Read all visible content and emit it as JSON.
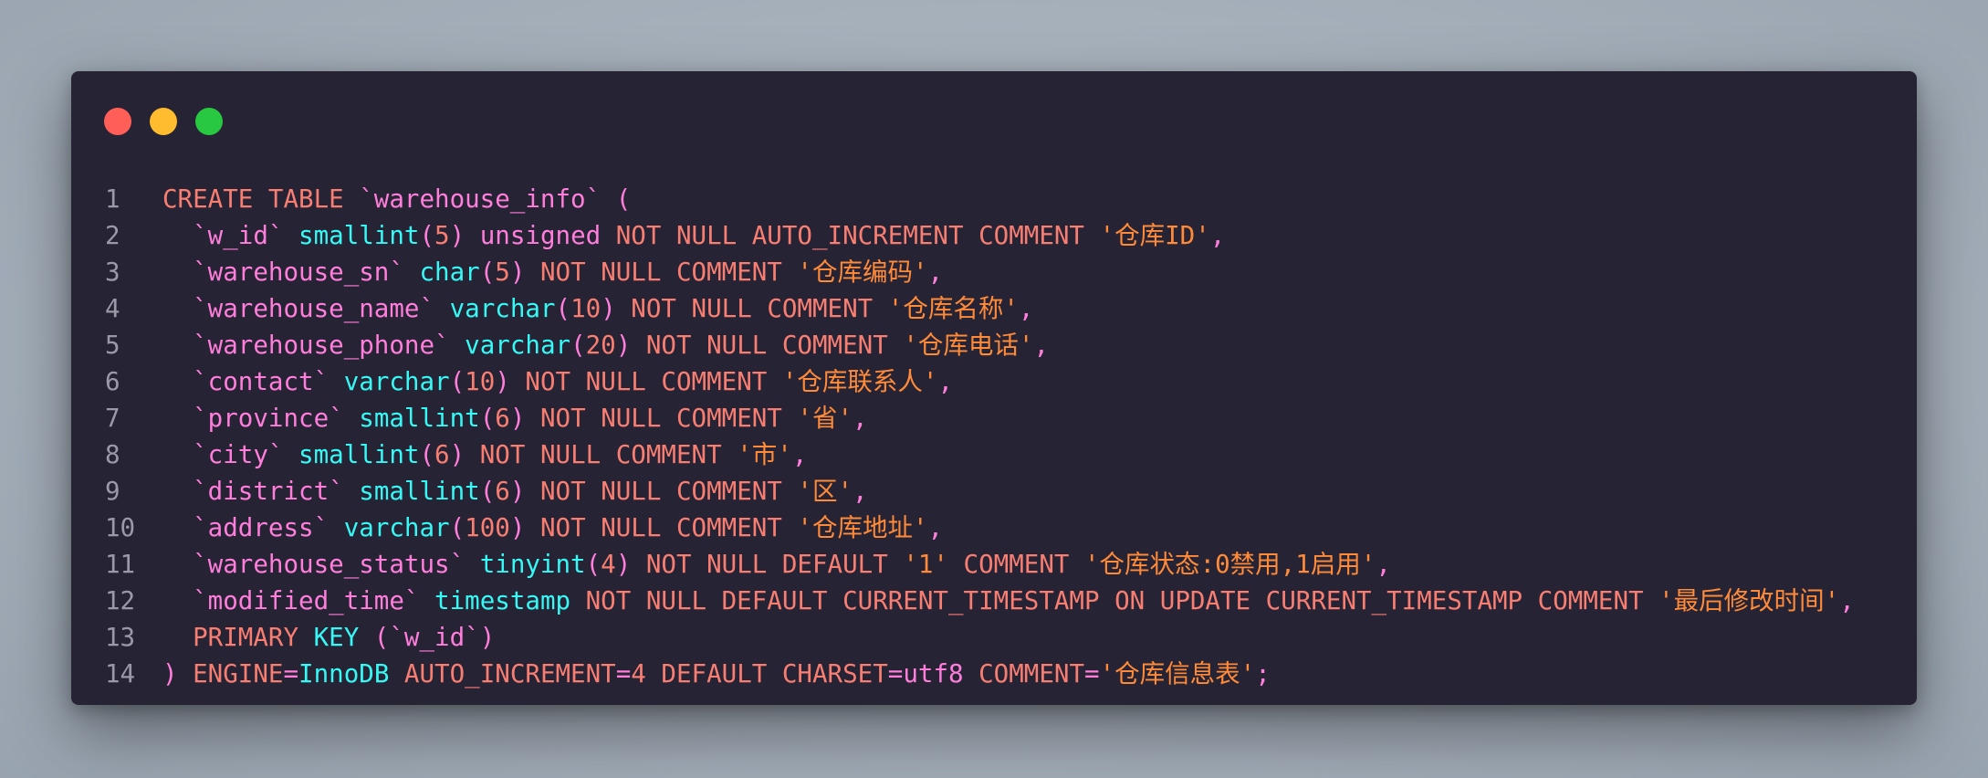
{
  "window": {
    "controls": [
      "close",
      "minimize",
      "maximize"
    ],
    "colors": {
      "background": "#262335",
      "close": "#ff5f57",
      "minimize": "#febc2e",
      "maximize": "#28c840",
      "keyword": "#f97e72",
      "type": "#36f9f6",
      "identifier": "#ff7edb",
      "string": "#ff8b39",
      "line_number": "#9b98a7"
    }
  },
  "code": {
    "language": "SQL",
    "lines": [
      {
        "n": "1",
        "tokens": [
          {
            "t": "CREATE TABLE ",
            "c": "kw2"
          },
          {
            "t": "`warehouse_info`",
            "c": "id"
          },
          {
            "t": " (",
            "c": "pun"
          }
        ]
      },
      {
        "n": "2",
        "tokens": [
          {
            "t": "  ",
            "c": "plain"
          },
          {
            "t": "`w_id`",
            "c": "id"
          },
          {
            "t": " ",
            "c": "plain"
          },
          {
            "t": "smallint",
            "c": "fn"
          },
          {
            "t": "(",
            "c": "pun"
          },
          {
            "t": "5",
            "c": "num"
          },
          {
            "t": ") ",
            "c": "pun"
          },
          {
            "t": "unsigned",
            "c": "id"
          },
          {
            "t": " NOT NULL AUTO_INCREMENT COMMENT ",
            "c": "kw2"
          },
          {
            "t": "'仓库ID'",
            "c": "str"
          },
          {
            "t": ",",
            "c": "pun"
          }
        ]
      },
      {
        "n": "3",
        "tokens": [
          {
            "t": "  ",
            "c": "plain"
          },
          {
            "t": "`warehouse_sn`",
            "c": "id"
          },
          {
            "t": " ",
            "c": "plain"
          },
          {
            "t": "char",
            "c": "fn"
          },
          {
            "t": "(",
            "c": "pun"
          },
          {
            "t": "5",
            "c": "num"
          },
          {
            "t": ")",
            "c": "pun"
          },
          {
            "t": " NOT NULL COMMENT ",
            "c": "kw2"
          },
          {
            "t": "'仓库编码'",
            "c": "str"
          },
          {
            "t": ",",
            "c": "pun"
          }
        ]
      },
      {
        "n": "4",
        "tokens": [
          {
            "t": "  ",
            "c": "plain"
          },
          {
            "t": "`warehouse_name`",
            "c": "id"
          },
          {
            "t": " ",
            "c": "plain"
          },
          {
            "t": "varchar",
            "c": "fn"
          },
          {
            "t": "(",
            "c": "pun"
          },
          {
            "t": "10",
            "c": "num"
          },
          {
            "t": ")",
            "c": "pun"
          },
          {
            "t": " NOT NULL COMMENT ",
            "c": "kw2"
          },
          {
            "t": "'仓库名称'",
            "c": "str"
          },
          {
            "t": ",",
            "c": "pun"
          }
        ]
      },
      {
        "n": "5",
        "tokens": [
          {
            "t": "  ",
            "c": "plain"
          },
          {
            "t": "`warehouse_phone`",
            "c": "id"
          },
          {
            "t": " ",
            "c": "plain"
          },
          {
            "t": "varchar",
            "c": "fn"
          },
          {
            "t": "(",
            "c": "pun"
          },
          {
            "t": "20",
            "c": "num"
          },
          {
            "t": ")",
            "c": "pun"
          },
          {
            "t": " NOT NULL COMMENT ",
            "c": "kw2"
          },
          {
            "t": "'仓库电话'",
            "c": "str"
          },
          {
            "t": ",",
            "c": "pun"
          }
        ]
      },
      {
        "n": "6",
        "tokens": [
          {
            "t": "  ",
            "c": "plain"
          },
          {
            "t": "`contact`",
            "c": "id"
          },
          {
            "t": " ",
            "c": "plain"
          },
          {
            "t": "varchar",
            "c": "fn"
          },
          {
            "t": "(",
            "c": "pun"
          },
          {
            "t": "10",
            "c": "num"
          },
          {
            "t": ")",
            "c": "pun"
          },
          {
            "t": " NOT NULL COMMENT ",
            "c": "kw2"
          },
          {
            "t": "'仓库联系人'",
            "c": "str"
          },
          {
            "t": ",",
            "c": "pun"
          }
        ]
      },
      {
        "n": "7",
        "tokens": [
          {
            "t": "  ",
            "c": "plain"
          },
          {
            "t": "`province`",
            "c": "id"
          },
          {
            "t": " ",
            "c": "plain"
          },
          {
            "t": "smallint",
            "c": "fn"
          },
          {
            "t": "(",
            "c": "pun"
          },
          {
            "t": "6",
            "c": "num"
          },
          {
            "t": ")",
            "c": "pun"
          },
          {
            "t": " NOT NULL COMMENT ",
            "c": "kw2"
          },
          {
            "t": "'省'",
            "c": "str"
          },
          {
            "t": ",",
            "c": "pun"
          }
        ]
      },
      {
        "n": "8",
        "tokens": [
          {
            "t": "  ",
            "c": "plain"
          },
          {
            "t": "`city`",
            "c": "id"
          },
          {
            "t": " ",
            "c": "plain"
          },
          {
            "t": "smallint",
            "c": "fn"
          },
          {
            "t": "(",
            "c": "pun"
          },
          {
            "t": "6",
            "c": "num"
          },
          {
            "t": ")",
            "c": "pun"
          },
          {
            "t": " NOT NULL COMMENT ",
            "c": "kw2"
          },
          {
            "t": "'市'",
            "c": "str"
          },
          {
            "t": ",",
            "c": "pun"
          }
        ]
      },
      {
        "n": "9",
        "tokens": [
          {
            "t": "  ",
            "c": "plain"
          },
          {
            "t": "`district`",
            "c": "id"
          },
          {
            "t": " ",
            "c": "plain"
          },
          {
            "t": "smallint",
            "c": "fn"
          },
          {
            "t": "(",
            "c": "pun"
          },
          {
            "t": "6",
            "c": "num"
          },
          {
            "t": ")",
            "c": "pun"
          },
          {
            "t": " NOT NULL COMMENT ",
            "c": "kw2"
          },
          {
            "t": "'区'",
            "c": "str"
          },
          {
            "t": ",",
            "c": "pun"
          }
        ]
      },
      {
        "n": "10",
        "tokens": [
          {
            "t": "  ",
            "c": "plain"
          },
          {
            "t": "`address`",
            "c": "id"
          },
          {
            "t": " ",
            "c": "plain"
          },
          {
            "t": "varchar",
            "c": "fn"
          },
          {
            "t": "(",
            "c": "pun"
          },
          {
            "t": "100",
            "c": "num"
          },
          {
            "t": ")",
            "c": "pun"
          },
          {
            "t": " NOT NULL COMMENT ",
            "c": "kw2"
          },
          {
            "t": "'仓库地址'",
            "c": "str"
          },
          {
            "t": ",",
            "c": "pun"
          }
        ]
      },
      {
        "n": "11",
        "tokens": [
          {
            "t": "  ",
            "c": "plain"
          },
          {
            "t": "`warehouse_status`",
            "c": "id"
          },
          {
            "t": " ",
            "c": "plain"
          },
          {
            "t": "tinyint",
            "c": "fn"
          },
          {
            "t": "(",
            "c": "pun"
          },
          {
            "t": "4",
            "c": "num"
          },
          {
            "t": ")",
            "c": "pun"
          },
          {
            "t": " NOT NULL DEFAULT ",
            "c": "kw2"
          },
          {
            "t": "'1'",
            "c": "str"
          },
          {
            "t": " COMMENT ",
            "c": "kw2"
          },
          {
            "t": "'仓库状态:0禁用,1启用'",
            "c": "str"
          },
          {
            "t": ",",
            "c": "pun"
          }
        ]
      },
      {
        "n": "12",
        "tokens": [
          {
            "t": "  ",
            "c": "plain"
          },
          {
            "t": "`modified_time`",
            "c": "id"
          },
          {
            "t": " ",
            "c": "plain"
          },
          {
            "t": "timestamp",
            "c": "fn"
          },
          {
            "t": " NOT NULL DEFAULT CURRENT_TIMESTAMP ON UPDATE CURRENT_TIMESTAMP COMMENT ",
            "c": "kw2"
          },
          {
            "t": "'最后修改时间'",
            "c": "str"
          },
          {
            "t": ",",
            "c": "pun"
          }
        ]
      },
      {
        "n": "13",
        "tokens": [
          {
            "t": "  ",
            "c": "plain"
          },
          {
            "t": "PRIMARY ",
            "c": "kw2"
          },
          {
            "t": "KEY",
            "c": "fn"
          },
          {
            "t": " (",
            "c": "pun"
          },
          {
            "t": "`w_id`",
            "c": "id"
          },
          {
            "t": ")",
            "c": "pun"
          }
        ]
      },
      {
        "n": "14",
        "tokens": [
          {
            "t": ")",
            "c": "pun"
          },
          {
            "t": " ENGINE",
            "c": "kw2"
          },
          {
            "t": "=",
            "c": "pun"
          },
          {
            "t": "InnoDB",
            "c": "fn"
          },
          {
            "t": " AUTO_INCREMENT",
            "c": "kw2"
          },
          {
            "t": "=",
            "c": "pun"
          },
          {
            "t": "4",
            "c": "num"
          },
          {
            "t": " DEFAULT CHARSET",
            "c": "kw2"
          },
          {
            "t": "=",
            "c": "pun"
          },
          {
            "t": "utf8",
            "c": "id"
          },
          {
            "t": " COMMENT",
            "c": "kw2"
          },
          {
            "t": "=",
            "c": "pun"
          },
          {
            "t": "'仓库信息表'",
            "c": "str"
          },
          {
            "t": ";",
            "c": "pun"
          }
        ]
      }
    ]
  }
}
